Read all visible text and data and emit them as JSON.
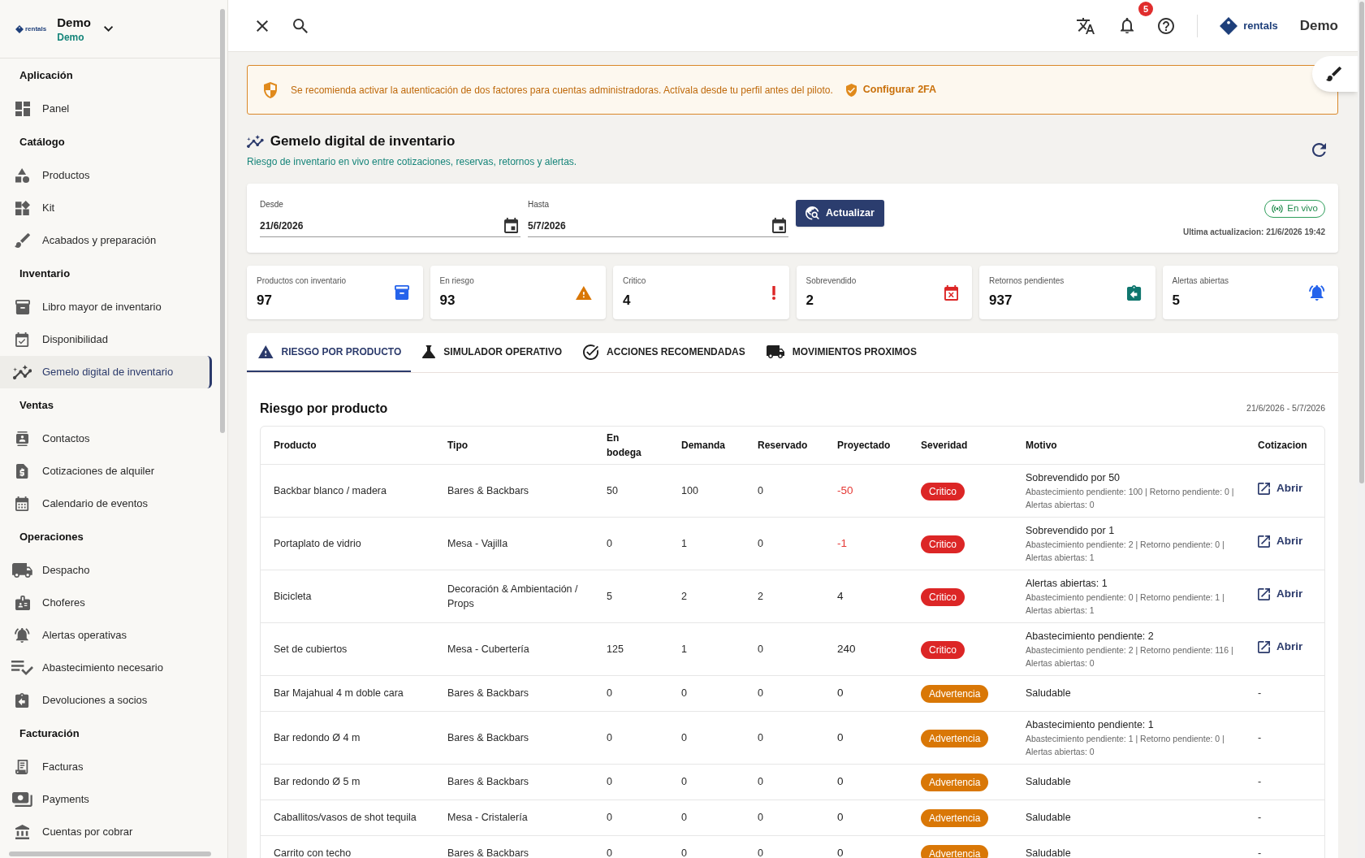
{
  "sidebar": {
    "logo_text": "rentals",
    "account": "Demo",
    "workspace": "Demo",
    "sections": [
      {
        "title": "Aplicación",
        "items": [
          {
            "label": "Panel",
            "selected": false
          }
        ]
      },
      {
        "title": "Catálogo",
        "items": [
          {
            "label": "Productos",
            "selected": false
          },
          {
            "label": "Kit",
            "selected": false
          },
          {
            "label": "Acabados y preparación",
            "selected": false
          }
        ]
      },
      {
        "title": "Inventario",
        "items": [
          {
            "label": "Libro mayor de inventario",
            "selected": false
          },
          {
            "label": "Disponibilidad",
            "selected": false
          },
          {
            "label": "Gemelo digital de inventario",
            "selected": true
          }
        ]
      },
      {
        "title": "Ventas",
        "items": [
          {
            "label": "Contactos",
            "selected": false
          },
          {
            "label": "Cotizaciones de alquiler",
            "selected": false
          },
          {
            "label": "Calendario de eventos",
            "selected": false
          }
        ]
      },
      {
        "title": "Operaciones",
        "items": [
          {
            "label": "Despacho",
            "selected": false
          },
          {
            "label": "Choferes",
            "selected": false
          },
          {
            "label": "Alertas operativas",
            "selected": false
          },
          {
            "label": "Abastecimiento necesario",
            "selected": false
          },
          {
            "label": "Devoluciones a socios",
            "selected": false
          }
        ]
      },
      {
        "title": "Facturación",
        "items": [
          {
            "label": "Facturas",
            "selected": false
          },
          {
            "label": "Payments",
            "selected": false
          },
          {
            "label": "Cuentas por cobrar",
            "selected": false
          }
        ]
      }
    ]
  },
  "topbar": {
    "notification_count": "5",
    "brand": "rentals",
    "user": "Demo"
  },
  "banner": {
    "message": "Se recomienda activar la autenticación de dos factores para cuentas administradoras. Actívala desde tu perfil antes del piloto.",
    "action": "Configurar 2FA"
  },
  "page": {
    "title": "Gemelo digital de inventario",
    "subtitle": "Riesgo de inventario en vivo entre cotizaciones, reservas, retornos y alertas."
  },
  "filters": {
    "fields": [
      {
        "label": "Desde",
        "value": "21/6/2026"
      },
      {
        "label": "Hasta",
        "value": "5/7/2026"
      }
    ],
    "button": "Actualizar",
    "live": "En vivo",
    "last_update": "Ultima actualizacion: 21/6/2026 19:42"
  },
  "stats": [
    {
      "label": "Productos con inventario",
      "value": "97",
      "color": "#2563eb"
    },
    {
      "label": "En riesgo",
      "value": "93",
      "color": "#d97706"
    },
    {
      "label": "Critico",
      "value": "4",
      "color": "#dc2626"
    },
    {
      "label": "Sobrevendido",
      "value": "2",
      "color": "#dc2626"
    },
    {
      "label": "Retornos pendientes",
      "value": "937",
      "color": "#0f766e"
    },
    {
      "label": "Alertas abiertas",
      "value": "5",
      "color": "#2563eb"
    }
  ],
  "tabs": [
    {
      "label": "RIESGO POR PRODUCTO",
      "selected": true
    },
    {
      "label": "SIMULADOR OPERATIVO",
      "selected": false
    },
    {
      "label": "ACCIONES RECOMENDADAS",
      "selected": false
    },
    {
      "label": "MOVIMIENTOS PROXIMOS",
      "selected": false
    }
  ],
  "risk_table": {
    "title": "Riesgo por producto",
    "range": "21/6/2026 - 5/7/2026",
    "columns": [
      "Producto",
      "Tipo",
      "En bodega",
      "Demanda",
      "Reservado",
      "Proyectado",
      "Severidad",
      "Motivo",
      "Cotizacion"
    ],
    "rows": [
      {
        "product": "Backbar blanco / madera",
        "type": "Bares & Backbars",
        "in_stock": "50",
        "demand": "100",
        "reserved": "0",
        "projected": "-50",
        "projected_negative": true,
        "severity": "Critico",
        "critical": true,
        "reason": "Sobrevendido por 50",
        "reason_detail": "Abastecimiento pendiente: 100 | Retorno pendiente: 0 | Alertas abiertas: 0",
        "quote": "Abrir",
        "link": true
      },
      {
        "product": "Portaplato de vidrio",
        "type": "Mesa - Vajilla",
        "in_stock": "0",
        "demand": "1",
        "reserved": "0",
        "projected": "-1",
        "projected_negative": true,
        "severity": "Critico",
        "critical": true,
        "reason": "Sobrevendido por 1",
        "reason_detail": "Abastecimiento pendiente: 2 | Retorno pendiente: 0 | Alertas abiertas: 1",
        "quote": "Abrir",
        "link": true
      },
      {
        "product": "Bicicleta",
        "type": "Decoración & Ambientación / Props",
        "in_stock": "5",
        "demand": "2",
        "reserved": "2",
        "projected": "4",
        "projected_negative": false,
        "severity": "Critico",
        "critical": true,
        "reason": "Alertas abiertas: 1",
        "reason_detail": "Abastecimiento pendiente: 0 | Retorno pendiente: 1 | Alertas abiertas: 1",
        "quote": "Abrir",
        "link": true
      },
      {
        "product": "Set de cubiertos",
        "type": "Mesa - Cubertería",
        "in_stock": "125",
        "demand": "1",
        "reserved": "0",
        "projected": "240",
        "projected_negative": false,
        "severity": "Critico",
        "critical": true,
        "reason": "Abastecimiento pendiente: 2",
        "reason_detail": "Abastecimiento pendiente: 2 | Retorno pendiente: 116 | Alertas abiertas: 0",
        "quote": "Abrir",
        "link": true
      },
      {
        "product": "Bar Majahual 4 m doble cara",
        "type": "Bares & Backbars",
        "in_stock": "0",
        "demand": "0",
        "reserved": "0",
        "projected": "0",
        "projected_negative": false,
        "severity": "Advertencia",
        "critical": false,
        "reason": "Saludable",
        "quote": "-",
        "link": false
      },
      {
        "product": "Bar redondo Ø 4 m",
        "type": "Bares & Backbars",
        "in_stock": "0",
        "demand": "0",
        "reserved": "0",
        "projected": "0",
        "projected_negative": false,
        "severity": "Advertencia",
        "critical": false,
        "reason": "Abastecimiento pendiente: 1",
        "reason_detail": "Abastecimiento pendiente: 1 | Retorno pendiente: 0 | Alertas abiertas: 0",
        "quote": "-",
        "link": false
      },
      {
        "product": "Bar redondo Ø 5 m",
        "type": "Bares & Backbars",
        "in_stock": "0",
        "demand": "0",
        "reserved": "0",
        "projected": "0",
        "projected_negative": false,
        "severity": "Advertencia",
        "critical": false,
        "reason": "Saludable",
        "quote": "-",
        "link": false
      },
      {
        "product": "Caballitos/vasos de shot tequila",
        "type": "Mesa - Cristalería",
        "in_stock": "0",
        "demand": "0",
        "reserved": "0",
        "projected": "0",
        "projected_negative": false,
        "severity": "Advertencia",
        "critical": false,
        "reason": "Saludable",
        "quote": "-",
        "link": false
      },
      {
        "product": "Carrito con techo",
        "type": "Bares & Backbars",
        "in_stock": "0",
        "demand": "0",
        "reserved": "0",
        "projected": "0",
        "projected_negative": false,
        "severity": "Advertencia",
        "critical": false,
        "reason": "Saludable",
        "quote": "-",
        "link": false
      }
    ]
  }
}
